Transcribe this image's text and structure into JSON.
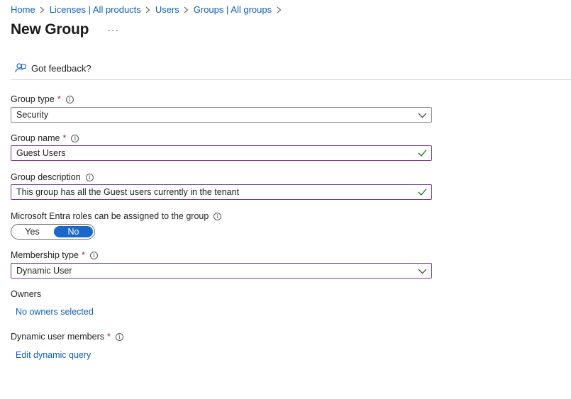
{
  "breadcrumb": {
    "items": [
      "Home",
      "Licenses | All products",
      "Users",
      "Groups | All groups"
    ]
  },
  "page": {
    "title": "New Group",
    "more_label": "···"
  },
  "toolbar": {
    "feedback_label": "Got feedback?",
    "feedback_icon": "feedback-person-icon"
  },
  "form": {
    "group_type": {
      "label": "Group type",
      "required": "*",
      "value": "Security"
    },
    "group_name": {
      "label": "Group name",
      "required": "*",
      "value": "Guest Users"
    },
    "group_description": {
      "label": "Group description",
      "value": "This group has all the Guest users currently in the tenant"
    },
    "roles": {
      "label": "Microsoft Entra roles can be assigned to the group",
      "yes": "Yes",
      "no": "No",
      "selected": "No"
    },
    "membership_type": {
      "label": "Membership type",
      "required": "*",
      "value": "Dynamic User"
    },
    "owners": {
      "label": "Owners",
      "link": "No owners selected"
    },
    "dynamic_members": {
      "label": "Dynamic user members",
      "required": "*",
      "link": "Edit dynamic query"
    }
  },
  "colors": {
    "link": "#0f5fb5",
    "accent": "#1a66c9",
    "required": "#a4262c",
    "valid": "#107c10",
    "focus_border": "#7a3a9a"
  }
}
